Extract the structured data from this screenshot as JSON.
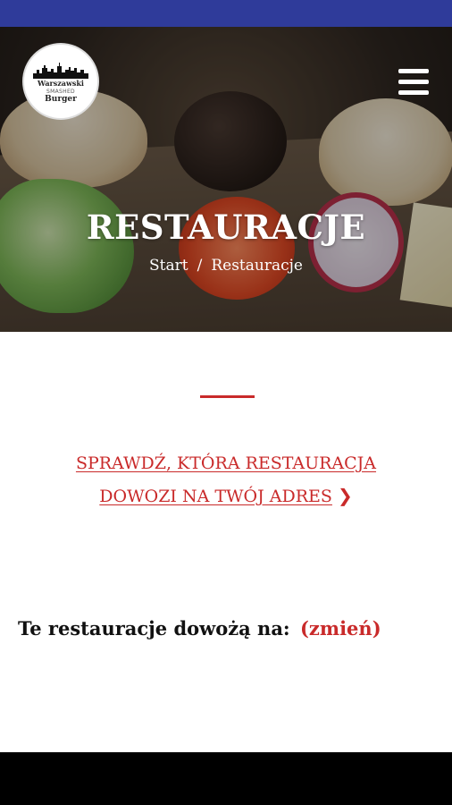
{
  "header": {
    "logo": {
      "line1": "Warszawski",
      "line2": "SMASHED",
      "line3": "Burger"
    },
    "menu_icon": "hamburger-menu-icon"
  },
  "hero": {
    "title": "RESTAURACJE",
    "breadcrumb": {
      "home": "Start",
      "separator": "/",
      "current": "Restauracje"
    }
  },
  "main": {
    "cta_line1": "SPRAWDŹ, KTÓRA RESTAURACJA",
    "cta_line2": "DOWOZI NA TWÓJ ADRES",
    "cta_icon": "chevron-right-icon",
    "delivery_label": "Te restauracje dowożą na:",
    "change_link": "(zmień)"
  },
  "colors": {
    "status_bar": "#2f3b9a",
    "accent": "#c92a2a",
    "nav_bar": "#000000"
  }
}
